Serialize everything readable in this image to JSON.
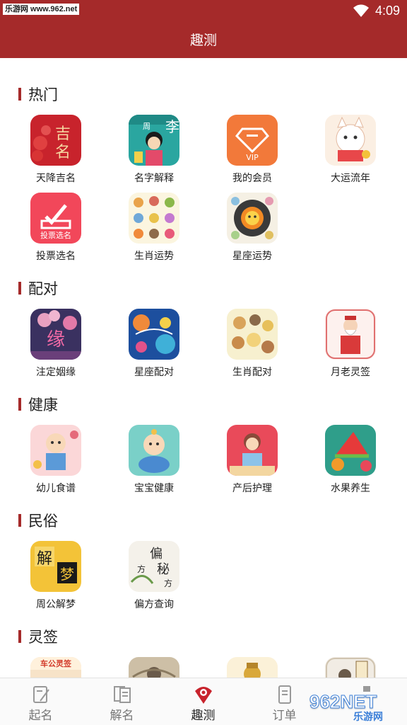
{
  "status_bar": {
    "watermark": "乐游网 www.962.net",
    "time": "4:09"
  },
  "header": {
    "title": "趣测"
  },
  "sections": [
    {
      "title": "热门",
      "items": [
        {
          "label": "天降吉名",
          "icon": "tianjiang-jiming-icon"
        },
        {
          "label": "名字解释",
          "icon": "mingzi-jieshi-icon"
        },
        {
          "label": "我的会员",
          "icon": "vip-member-icon",
          "icon_text": "VIP"
        },
        {
          "label": "大运流年",
          "icon": "lucky-cat-icon"
        },
        {
          "label": "投票选名",
          "icon": "vote-icon",
          "icon_text": "投票选名"
        },
        {
          "label": "生肖运势",
          "icon": "zodiac-animals-icon"
        },
        {
          "label": "星座运势",
          "icon": "constellation-wheel-icon"
        }
      ]
    },
    {
      "title": "配对",
      "items": [
        {
          "label": "注定姻缘",
          "icon": "fate-marriage-icon"
        },
        {
          "label": "星座配对",
          "icon": "constellation-pair-icon"
        },
        {
          "label": "生肖配对",
          "icon": "zodiac-pair-icon"
        },
        {
          "label": "月老灵签",
          "icon": "yuelao-icon"
        }
      ]
    },
    {
      "title": "健康",
      "items": [
        {
          "label": "幼儿食谱",
          "icon": "baby-recipe-icon"
        },
        {
          "label": "宝宝健康",
          "icon": "baby-health-icon"
        },
        {
          "label": "产后护理",
          "icon": "postpartum-care-icon"
        },
        {
          "label": "水果养生",
          "icon": "fruit-health-icon"
        }
      ]
    },
    {
      "title": "民俗",
      "items": [
        {
          "label": "周公解梦",
          "icon": "dream-interpretation-icon"
        },
        {
          "label": "偏方查询",
          "icon": "folk-remedy-icon"
        }
      ]
    },
    {
      "title": "灵签",
      "items": [
        {
          "label": "",
          "icon": "guanyin-lingqian-icon",
          "icon_text": "车公灵签"
        },
        {
          "label": "",
          "icon": "lingqian-painting-icon"
        },
        {
          "label": "",
          "icon": "golden-deity-icon"
        },
        {
          "label": "",
          "icon": "lvzu-icon"
        }
      ]
    }
  ],
  "bottom_nav": [
    {
      "label": "起名",
      "icon": "name-giving-icon",
      "active": false
    },
    {
      "label": "解名",
      "icon": "name-analysis-icon",
      "active": false
    },
    {
      "label": "趣测",
      "icon": "fortune-test-icon",
      "active": true
    },
    {
      "label": "订单",
      "icon": "order-icon",
      "active": false
    },
    {
      "label": "",
      "icon": "profile-icon",
      "active": false
    }
  ],
  "watermark": {
    "big": "962NET",
    "small": "乐游网"
  },
  "colors": {
    "primary": "#a52a2a",
    "background": "#ffffff",
    "text": "#222222"
  }
}
